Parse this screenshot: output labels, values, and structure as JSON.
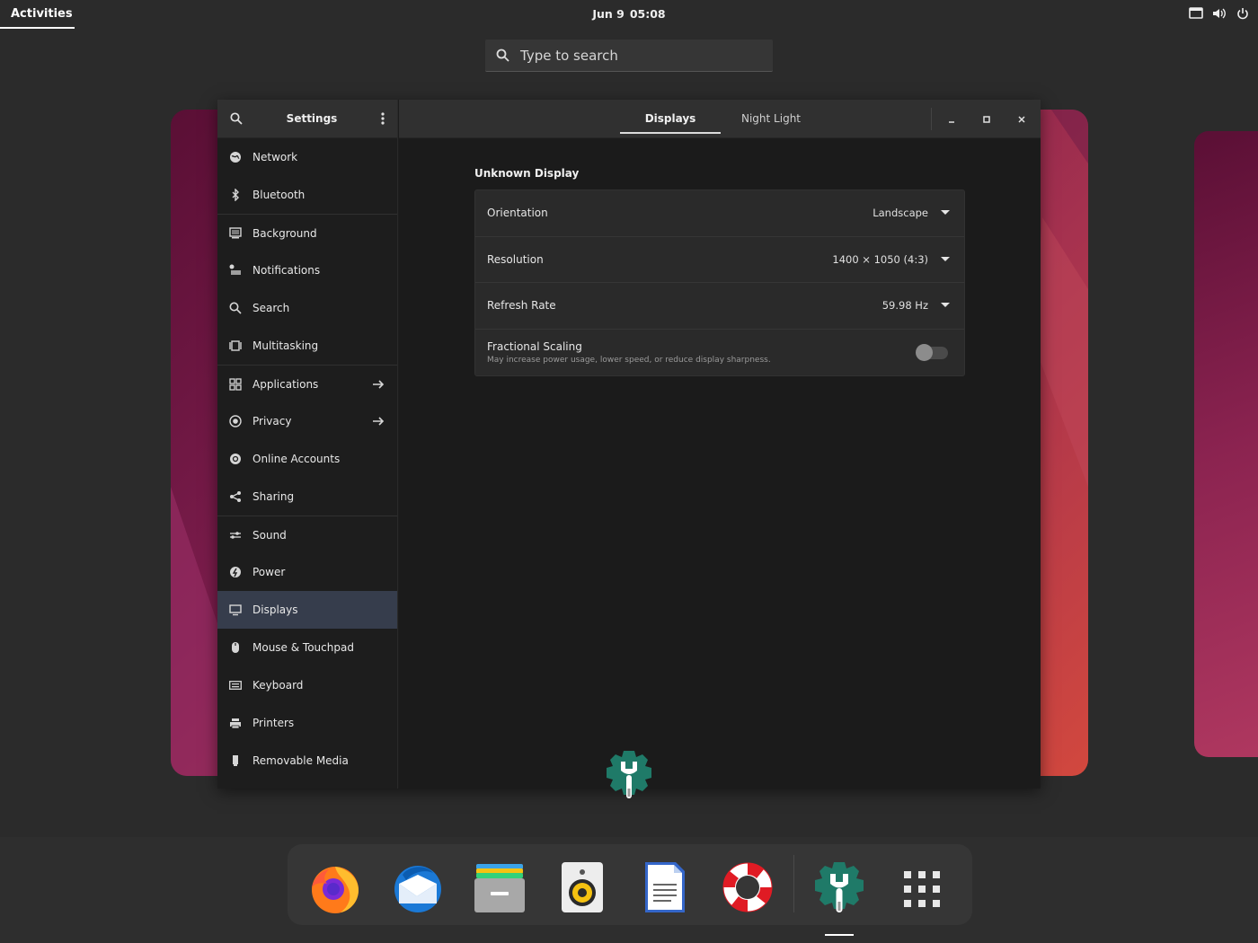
{
  "topbar": {
    "activities": "Activities",
    "date": "Jun 9",
    "time": "05:08",
    "tray_icons": [
      "screen-icon",
      "volume-icon",
      "power-icon"
    ]
  },
  "overview_search": {
    "placeholder": "Type to search"
  },
  "settings": {
    "sidebar_title": "Settings",
    "items": [
      {
        "label": "Network",
        "icon": "network-icon"
      },
      {
        "label": "Bluetooth",
        "icon": "bluetooth-icon"
      },
      {
        "label": "Background",
        "icon": "background-icon"
      },
      {
        "label": "Notifications",
        "icon": "notifications-icon"
      },
      {
        "label": "Search",
        "icon": "search-icon"
      },
      {
        "label": "Multitasking",
        "icon": "multitasking-icon"
      },
      {
        "label": "Applications",
        "icon": "applications-icon"
      },
      {
        "label": "Privacy",
        "icon": "privacy-icon"
      },
      {
        "label": "Online Accounts",
        "icon": "online-accounts-icon"
      },
      {
        "label": "Sharing",
        "icon": "sharing-icon"
      },
      {
        "label": "Sound",
        "icon": "sound-icon"
      },
      {
        "label": "Power",
        "icon": "power-icon"
      },
      {
        "label": "Displays",
        "icon": "displays-icon"
      },
      {
        "label": "Mouse & Touchpad",
        "icon": "mouse-icon"
      },
      {
        "label": "Keyboard",
        "icon": "keyboard-icon"
      },
      {
        "label": "Printers",
        "icon": "printer-icon"
      },
      {
        "label": "Removable Media",
        "icon": "removable-media-icon"
      }
    ],
    "active_item": "Displays",
    "tabs": [
      "Displays",
      "Night Light"
    ],
    "active_tab": "Displays",
    "display_name": "Unknown Display",
    "rows": {
      "orientation": {
        "label": "Orientation",
        "value": "Landscape"
      },
      "resolution": {
        "label": "Resolution",
        "value": "1400 × 1050 (4:3)"
      },
      "refresh_rate": {
        "label": "Refresh Rate",
        "value": "59.98 Hz"
      },
      "fractional_scaling": {
        "label": "Fractional Scaling",
        "description": "May increase power usage, lower speed, or reduce display sharpness.",
        "enabled": false
      }
    }
  },
  "dock": {
    "apps": [
      "firefox-icon",
      "thunderbird-icon",
      "files-icon",
      "rhythmbox-icon",
      "writer-icon",
      "help-icon",
      "settings-icon",
      "app-grid-icon"
    ]
  },
  "colors": {
    "accent_selected": "#363d4c",
    "settings_green": "#1f7a68"
  }
}
